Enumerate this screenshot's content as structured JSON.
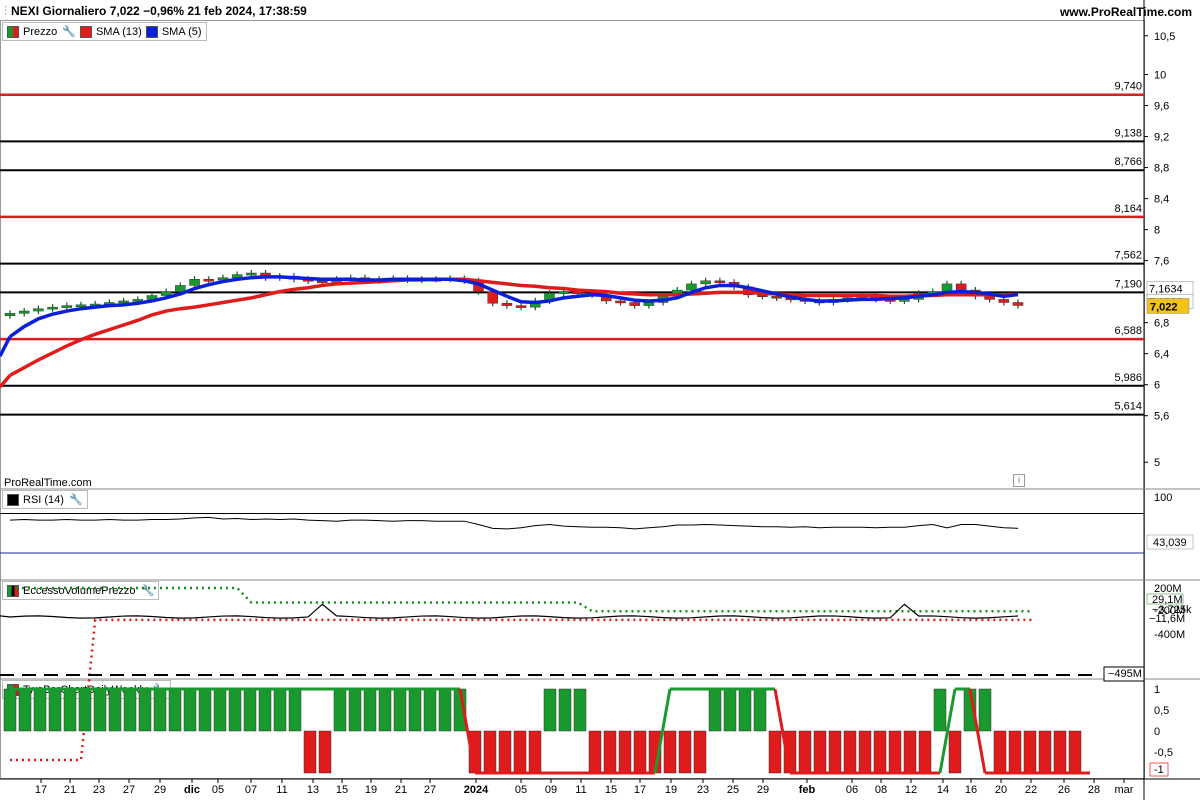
{
  "header": {
    "symbol_icon": "chart-icon",
    "title": "NEXI Giornaliero 7,022 −0,96% 21 feb 2024, 17:38:59",
    "site": "www.ProRealTime.com"
  },
  "legends": {
    "price": {
      "label": "Prezzo",
      "sma13": "SMA (13)",
      "sma5": "SMA (5)"
    },
    "rsi": "RSI (14)",
    "evp": "EccessoVolumePrezzo",
    "twobar": "TwoBarChartDailyWeekly"
  },
  "watermark": "ProRealTime.com",
  "colors": {
    "up": "#1a9a2e",
    "down": "#e01b1b",
    "sma13": "#e01b1b",
    "sma5": "#0a1fd8",
    "level_red": "#e01b1b",
    "level_black": "#000000"
  },
  "chart_data": [
    {
      "type": "candlestick",
      "title": "NEXI Giornaliero",
      "ylim": [
        4.9,
        10.6
      ],
      "y_ticks": [
        "10,5",
        "10",
        "9,6",
        "9,2",
        "8,8",
        "8,4",
        "8",
        "7,6",
        "6,8",
        "6,4",
        "6",
        "5,6",
        "5"
      ],
      "x_ticks": [
        "17",
        "21",
        "23",
        "27",
        "29",
        "dic",
        "05",
        "07",
        "11",
        "13",
        "15",
        "19",
        "21",
        "27",
        "2024",
        "05",
        "09",
        "11",
        "15",
        "17",
        "19",
        "23",
        "25",
        "29",
        "feb",
        "06",
        "08",
        "12",
        "14",
        "16",
        "20",
        "22",
        "26",
        "28",
        "mar"
      ],
      "levels": [
        {
          "value": 9.74,
          "label": "9,740",
          "color": "red"
        },
        {
          "value": 9.138,
          "label": "9,138",
          "color": "black"
        },
        {
          "value": 8.766,
          "label": "8,766",
          "color": "black"
        },
        {
          "value": 8.164,
          "label": "8,164",
          "color": "red"
        },
        {
          "value": 7.562,
          "label": "7,562",
          "color": "black"
        },
        {
          "value": 7.19,
          "label": "7,190",
          "color": "black"
        },
        {
          "value": 6.588,
          "label": "6,588",
          "color": "red"
        },
        {
          "value": 5.986,
          "label": "5,986",
          "color": "black"
        },
        {
          "value": 5.614,
          "label": "5,614",
          "color": "black"
        }
      ],
      "close": [
        6.92,
        6.95,
        6.98,
        7.0,
        7.02,
        7.03,
        7.04,
        7.06,
        7.08,
        7.1,
        7.15,
        7.2,
        7.28,
        7.36,
        7.35,
        7.38,
        7.42,
        7.44,
        7.38,
        7.4,
        7.36,
        7.34,
        7.32,
        7.36,
        7.38,
        7.34,
        7.36,
        7.37,
        7.35,
        7.36,
        7.36,
        7.37,
        7.34,
        7.2,
        7.05,
        7.02,
        7.0,
        7.08,
        7.18,
        7.2,
        7.18,
        7.16,
        7.08,
        7.06,
        7.02,
        7.06,
        7.14,
        7.22,
        7.3,
        7.34,
        7.32,
        7.26,
        7.16,
        7.14,
        7.12,
        7.1,
        7.08,
        7.06,
        7.1,
        7.12,
        7.14,
        7.1,
        7.08,
        7.1,
        7.18,
        7.2,
        7.3,
        7.22,
        7.14,
        7.1,
        7.06,
        7.022
      ],
      "sma13": [
        6.12,
        6.22,
        6.32,
        6.41,
        6.5,
        6.58,
        6.65,
        6.71,
        6.77,
        6.83,
        6.9,
        6.95,
        6.98,
        7.0,
        7.03,
        7.06,
        7.09,
        7.12,
        7.16,
        7.2,
        7.23,
        7.25,
        7.28,
        7.3,
        7.31,
        7.32,
        7.33,
        7.34,
        7.35,
        7.35,
        7.36,
        7.36,
        7.36,
        7.34,
        7.32,
        7.3,
        7.28,
        7.27,
        7.25,
        7.24,
        7.22,
        7.21,
        7.2,
        7.18,
        7.17,
        7.16,
        7.16,
        7.16,
        7.17,
        7.18,
        7.19,
        7.19,
        7.19,
        7.18,
        7.17,
        7.16,
        7.15,
        7.15,
        7.15,
        7.15,
        7.15,
        7.15,
        7.14,
        7.14,
        7.15,
        7.15,
        7.16,
        7.16,
        7.16,
        7.16,
        7.16,
        7.1634
      ],
      "sma5": [
        6.62,
        6.75,
        6.85,
        6.91,
        6.95,
        6.98,
        7.0,
        7.02,
        7.03,
        7.05,
        7.08,
        7.12,
        7.17,
        7.24,
        7.29,
        7.33,
        7.36,
        7.38,
        7.39,
        7.39,
        7.38,
        7.37,
        7.36,
        7.36,
        7.36,
        7.35,
        7.35,
        7.36,
        7.36,
        7.36,
        7.36,
        7.36,
        7.34,
        7.3,
        7.22,
        7.14,
        7.07,
        7.06,
        7.08,
        7.12,
        7.14,
        7.16,
        7.15,
        7.12,
        7.09,
        7.08,
        7.09,
        7.12,
        7.19,
        7.25,
        7.28,
        7.28,
        7.25,
        7.21,
        7.17,
        7.13,
        7.1,
        7.08,
        7.08,
        7.09,
        7.1,
        7.1,
        7.11,
        7.12,
        7.14,
        7.16,
        7.19,
        7.2,
        7.19,
        7.17,
        7.14,
        7.1632
      ],
      "last_price": "7,022",
      "sma13_last": "7,1634",
      "sma5_last": "7,1632"
    },
    {
      "type": "line",
      "title": "RSI (14)",
      "ylim": [
        0,
        100
      ],
      "y_ticks": [
        "100"
      ],
      "last": "43,039",
      "values": [
        58,
        59,
        58,
        58,
        59,
        58,
        58,
        59,
        58,
        58,
        59,
        59,
        60,
        62,
        63,
        60,
        61,
        59,
        60,
        59,
        60,
        58,
        57,
        56,
        58,
        58,
        57,
        56,
        57,
        57,
        56,
        56,
        56,
        50,
        43,
        42,
        44,
        48,
        50,
        47,
        46,
        45,
        45,
        44,
        42,
        44,
        46,
        49,
        49,
        50,
        49,
        48,
        47,
        46,
        46,
        45,
        46,
        44,
        45,
        45,
        45,
        44,
        45,
        45,
        48,
        50,
        44,
        50,
        50,
        47,
        44,
        43.039
      ]
    },
    {
      "type": "line",
      "title": "EccessoVolumePrezzo",
      "ylim": [
        -495,
        200
      ],
      "y_ticks": [
        "200M",
        "0",
        "-200M",
        "-400M"
      ],
      "labels": [
        "29,1M",
        "−3,725k",
        "−11,6M",
        "−495M"
      ],
      "dotted_green": [
        [
          0,
          1.0
        ],
        [
          16,
          1.0
        ],
        [
          17,
          0.75
        ],
        [
          40,
          0.75
        ],
        [
          41,
          0.6
        ],
        [
          72,
          0.6
        ]
      ],
      "dotted_red": [
        [
          0,
          0.0
        ],
        [
          5,
          0.0
        ],
        [
          6,
          0.45
        ],
        [
          72,
          0.45
        ]
      ],
      "solid_black_level": 0.5
    },
    {
      "type": "bar",
      "title": "TwoBarChartDailyWeekly",
      "ylim": [
        -1,
        1
      ],
      "y_ticks": [
        "1",
        "0,5",
        "0",
        "-0,5",
        "-1"
      ],
      "last": "-1",
      "values": [
        1,
        1,
        1,
        1,
        1,
        1,
        1,
        1,
        1,
        1,
        1,
        1,
        1,
        1,
        1,
        1,
        1,
        1,
        1,
        1,
        -1,
        -1,
        1,
        1,
        1,
        1,
        1,
        1,
        1,
        1,
        1,
        -1,
        -1,
        -1,
        -1,
        -1,
        1,
        1,
        1,
        -1,
        -1,
        -1,
        -1,
        -1,
        -1,
        -1,
        -1,
        1,
        1,
        1,
        1,
        -1,
        -1,
        -1,
        -1,
        -1,
        -1,
        -1,
        -1,
        -1,
        -1,
        -1,
        1,
        -1,
        1,
        1,
        -1,
        -1,
        -1,
        -1,
        -1,
        -1
      ],
      "weekly": [
        [
          0,
          1
        ],
        [
          30,
          1
        ],
        [
          31,
          -1
        ],
        [
          43,
          -1
        ],
        [
          44,
          1
        ],
        [
          51,
          1
        ],
        [
          52,
          -1
        ],
        [
          62,
          -1
        ],
        [
          63,
          1
        ],
        [
          64,
          1
        ],
        [
          65,
          -1
        ],
        [
          72,
          -1
        ]
      ]
    }
  ]
}
